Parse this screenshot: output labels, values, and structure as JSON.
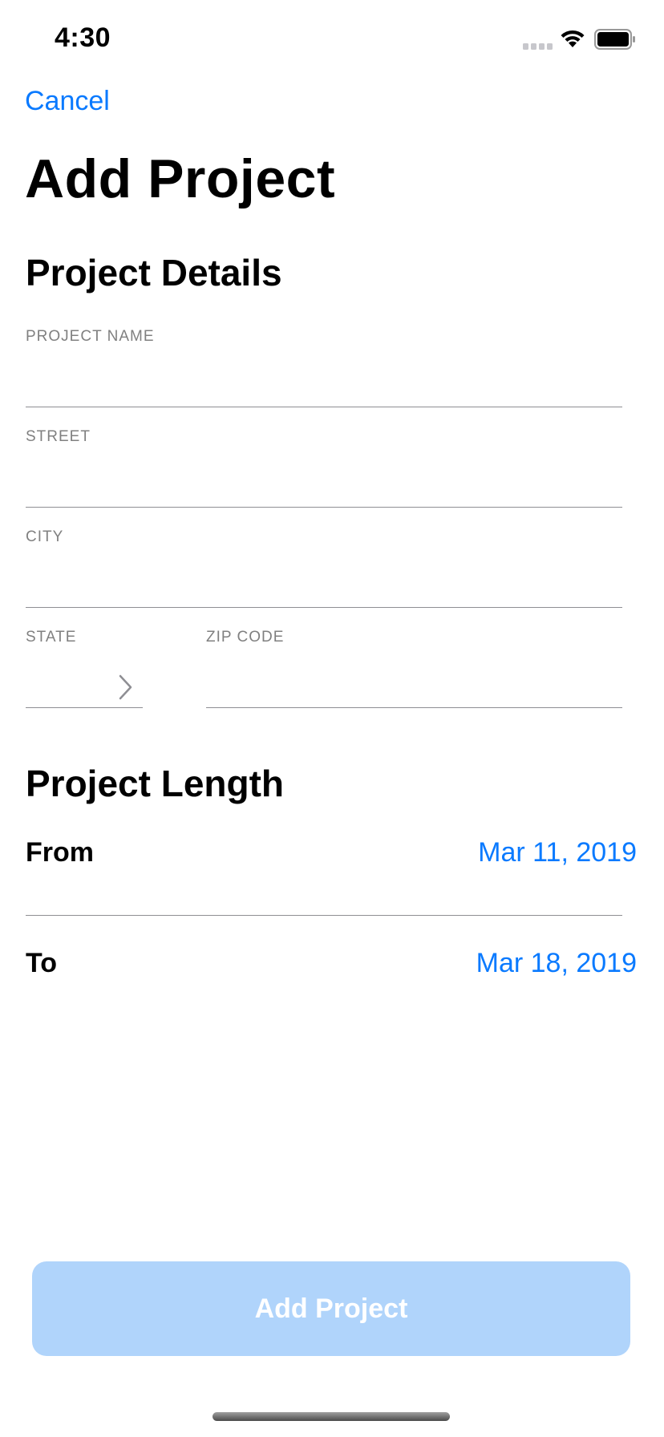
{
  "status_bar": {
    "time": "4:30",
    "icons": [
      "signal-icon",
      "wifi-icon",
      "battery-icon"
    ]
  },
  "nav": {
    "cancel_label": "Cancel",
    "title": "Add Project"
  },
  "project_details": {
    "section_title": "Project Details",
    "fields": {
      "project_name": {
        "label": "PROJECT NAME",
        "value": ""
      },
      "street": {
        "label": "STREET",
        "value": ""
      },
      "city": {
        "label": "CITY",
        "value": ""
      },
      "state": {
        "label": "STATE",
        "value": ""
      },
      "zip_code": {
        "label": "ZIP CODE",
        "value": ""
      }
    }
  },
  "project_length": {
    "section_title": "Project Length",
    "from": {
      "label": "From",
      "value": "Mar 11, 2019"
    },
    "to": {
      "label": "To",
      "value": "Mar 18, 2019"
    }
  },
  "footer": {
    "add_button_label": "Add Project"
  },
  "colors": {
    "accent": "#0a7aff",
    "button_disabled": "#b0d4fb",
    "label_gray": "#808080",
    "divider": "#8e8e93"
  }
}
